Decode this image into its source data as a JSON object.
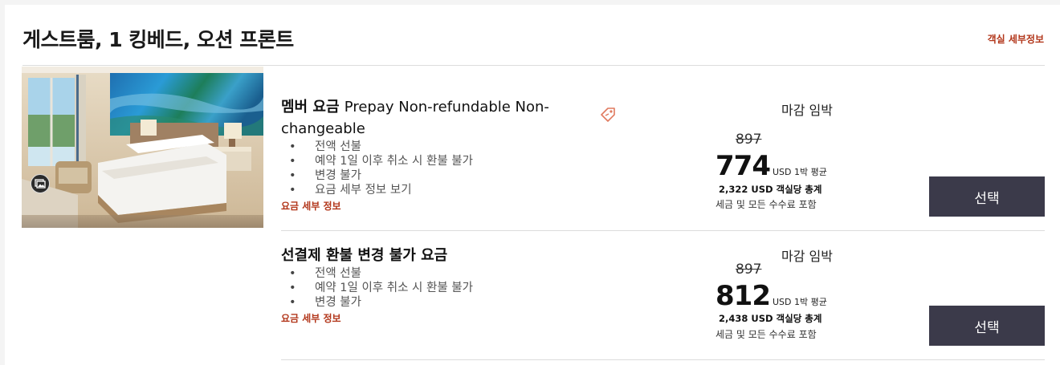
{
  "room": {
    "title": "게스트룸, 1 킹베드, 오션 프론트",
    "details_link": "객실 세부정보",
    "photo_icon": "gallery-icon"
  },
  "rates": [
    {
      "name_ko": "멤버 요금",
      "name_en": "Prepay Non-refundable Non-changeable",
      "bullets": [
        "전액 선불",
        "예약 1일 이후 취소 시 환불 불가",
        "변경 불가",
        "요금 세부 정보 보기"
      ],
      "details_link": "요금 세부 정보",
      "deadline": "마감 임박",
      "old_price": "897",
      "price": "774",
      "price_unit": "USD 1박 평균",
      "total": "2,322 USD 객실당 총계",
      "tax_note": "세금 및 모든 수수료 포함",
      "select_label": "선택",
      "tag_icon": "price-tag-icon"
    },
    {
      "name_ko": "선결제 환불 변경 불가 요금",
      "name_en": "",
      "bullets": [
        "전액 선불",
        "예약 1일 이후 취소 시 환불 불가",
        "변경 불가"
      ],
      "details_link": "요금 세부 정보",
      "deadline": "마감 임박",
      "old_price": "897",
      "price": "812",
      "price_unit": "USD 1박 평균",
      "total": "2,438 USD 객실당 총계",
      "tax_note": "세금 및 모든 수수료 포함",
      "select_label": "선택"
    }
  ],
  "colors": {
    "accent_link": "#b2361a",
    "button_bg": "#3b3a4a",
    "tag_icon": "#e07a5f"
  }
}
